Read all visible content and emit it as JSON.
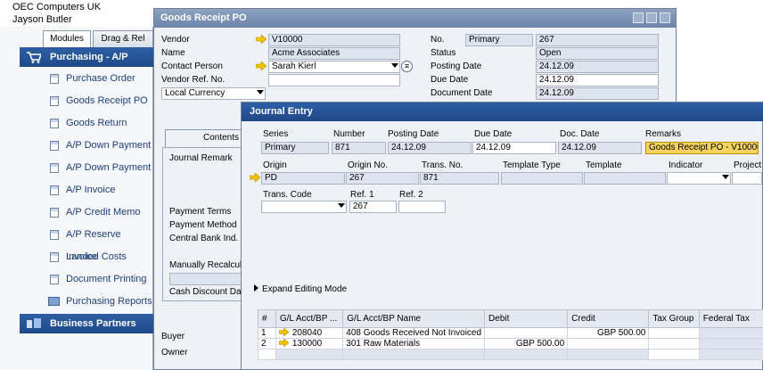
{
  "company": {
    "name": "OEC Computers UK",
    "user": "Jayson Butler"
  },
  "sidebar": {
    "tabs": [
      {
        "label": "Modules"
      },
      {
        "label": "Drag & Rel"
      }
    ],
    "module_title": "Purchasing - A/P",
    "items": [
      {
        "label": "Purchase Order",
        "icon": "document-icon"
      },
      {
        "label": "Goods Receipt PO",
        "icon": "document-icon"
      },
      {
        "label": "Goods Return",
        "icon": "document-icon"
      },
      {
        "label": "A/P Down Payment",
        "icon": "document-icon"
      },
      {
        "label": "A/P Down Payment",
        "icon": "document-icon"
      },
      {
        "label": "A/P Invoice",
        "icon": "document-icon"
      },
      {
        "label": "A/P Credit Memo",
        "icon": "document-icon"
      },
      {
        "label": "A/P Reserve Invoice",
        "icon": "document-icon"
      },
      {
        "label": "Landed Costs",
        "icon": "document-icon"
      },
      {
        "label": "Document Printing",
        "icon": "document-icon"
      },
      {
        "label": "Purchasing Reports",
        "icon": "folder-icon"
      }
    ],
    "next_module": "Business Partners"
  },
  "goods_receipt": {
    "title": "Goods Receipt PO",
    "vendor_label": "Vendor",
    "vendor_value": "V10000",
    "name_label": "Name",
    "name_value": "Acme Associates",
    "contact_label": "Contact Person",
    "contact_value": "Sarah Kierl",
    "vendor_ref_label": "Vendor Ref. No.",
    "vendor_ref_value": "",
    "currency_value": "Local Currency",
    "no_label": "No.",
    "no_series": "Primary",
    "no_value": "267",
    "status_label": "Status",
    "status_value": "Open",
    "posting_date_label": "Posting Date",
    "posting_date_value": "24.12.09",
    "due_date_label": "Due Date",
    "due_date_value": "24.12.09",
    "document_date_label": "Document Date",
    "document_date_value": "24.12.09",
    "contents_tab": "Contents",
    "journal_remark_label": "Journal Remark",
    "payment_terms_label": "Payment Terms",
    "payment_method_label": "Payment Method",
    "central_bank_label": "Central Bank Ind.",
    "manually_recalc_label": "Manually Recalcul",
    "cash_discount_label": "Cash Discount Da",
    "buyer_label": "Buyer",
    "owner_label": "Owner"
  },
  "journal_entry": {
    "title": "Journal Entry",
    "series_label": "Series",
    "series_value": "Primary",
    "number_label": "Number",
    "number_value": "871",
    "posting_date_label": "Posting Date",
    "posting_date_value": "24.12.09",
    "due_date_label": "Due Date",
    "due_date_value": "24.12.09",
    "doc_date_label": "Doc. Date",
    "doc_date_value": "24.12.09",
    "remarks_label": "Remarks",
    "remarks_value": "Goods Receipt PO - V10000",
    "origin_label": "Origin",
    "origin_value": "PD",
    "origin_no_label": "Origin No.",
    "origin_no_value": "267",
    "trans_no_label": "Trans. No.",
    "trans_no_value": "871",
    "template_type_label": "Template Type",
    "template_type_value": "",
    "template_label": "Template",
    "template_value": "",
    "indicator_label": "Indicator",
    "indicator_value": "",
    "project_label": "Project",
    "project_value": "",
    "trans_code_label": "Trans. Code",
    "trans_code_value": "",
    "ref1_label": "Ref. 1",
    "ref1_value": "267",
    "ref2_label": "Ref. 2",
    "ref2_value": "",
    "expand_label": "Expand Editing Mode",
    "grid": {
      "headers": [
        "#",
        "G/L Acct/BP ...",
        "G/L Acct/BP Name",
        "Debit",
        "Credit",
        "Tax Group",
        "Federal Tax"
      ],
      "rows": [
        {
          "num": "1",
          "acct": "208040",
          "name": "408 Goods Received Not Invoiced",
          "debit": "",
          "credit": "GBP 500.00"
        },
        {
          "num": "2",
          "acct": "130000",
          "name": "301 Raw Materials",
          "debit": "GBP 500.00",
          "credit": ""
        }
      ]
    }
  },
  "colors": {
    "title_active": "#2d5ea6",
    "title_inactive": "#7d93b6",
    "field_bg": "#dde4ee",
    "arrow": "#f2c200"
  }
}
